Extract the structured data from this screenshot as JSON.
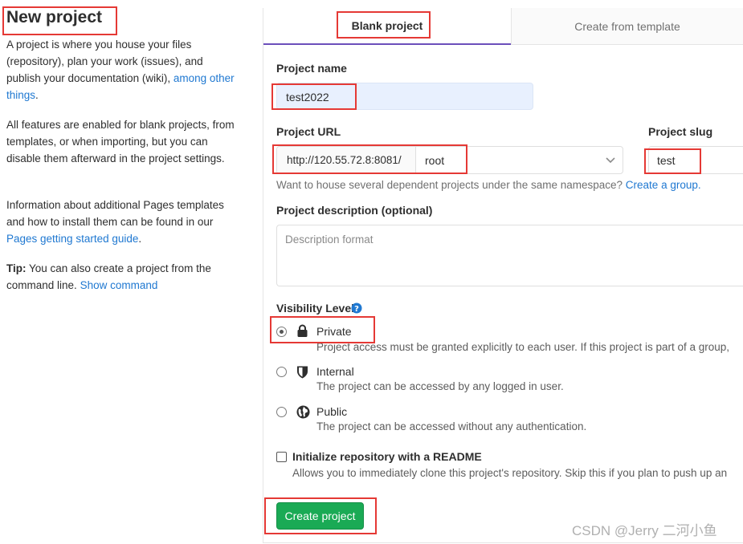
{
  "left": {
    "title": "New project",
    "p1_text": "A project is where you house your files (repository), plan your work (issues), and publish your documentation (wiki),",
    "p1_link": "among other things",
    "p1_end": ".",
    "p2": "All features are enabled for blank projects, from templates, or when importing, but you can disable them afterward in the project settings.",
    "p3_text": "Information about additional Pages templates and how to install them can be found in our",
    "p3_link": "Pages getting started guide",
    "p3_end": ".",
    "tip_bold": "Tip:",
    "tip_text": "You can also create a project from the command line.",
    "tip_link": "Show command"
  },
  "tabs": {
    "blank": "Blank project",
    "template": "Create from template"
  },
  "form": {
    "project_name_label": "Project name",
    "project_name_value": "test2022",
    "project_url_label": "Project URL",
    "url_prefix": "http://120.55.72.8:8081/",
    "namespace_value": "root",
    "project_slug_label": "Project slug",
    "project_slug_value": "test",
    "namespace_hint": "Want to house several dependent projects under the same namespace?",
    "namespace_hint_link": "Create a group.",
    "description_label": "Project description (optional)",
    "description_placeholder": "Description format",
    "visibility_label": "Visibility Level",
    "visibility_options": [
      {
        "label": "Private",
        "desc": "Project access must be granted explicitly to each user. If this project is part of a group,",
        "icon": "lock-icon",
        "selected": true
      },
      {
        "label": "Internal",
        "desc": "The project can be accessed by any logged in user.",
        "icon": "shield-icon",
        "selected": false
      },
      {
        "label": "Public",
        "desc": "The project can be accessed without any authentication.",
        "icon": "globe-icon",
        "selected": false
      }
    ],
    "readme_label": "Initialize repository with a README",
    "readme_desc": "Allows you to immediately clone this project's repository. Skip this if you plan to push up an",
    "create_button": "Create project"
  },
  "watermark": "CSDN @Jerry 二河小鱼",
  "colors": {
    "link": "#1f78d1",
    "primary_button": "#1aaa55",
    "tab_active_border": "#6b4fbb",
    "annotation_box": "#e53935",
    "name_input_bg": "#e8f0fe"
  }
}
